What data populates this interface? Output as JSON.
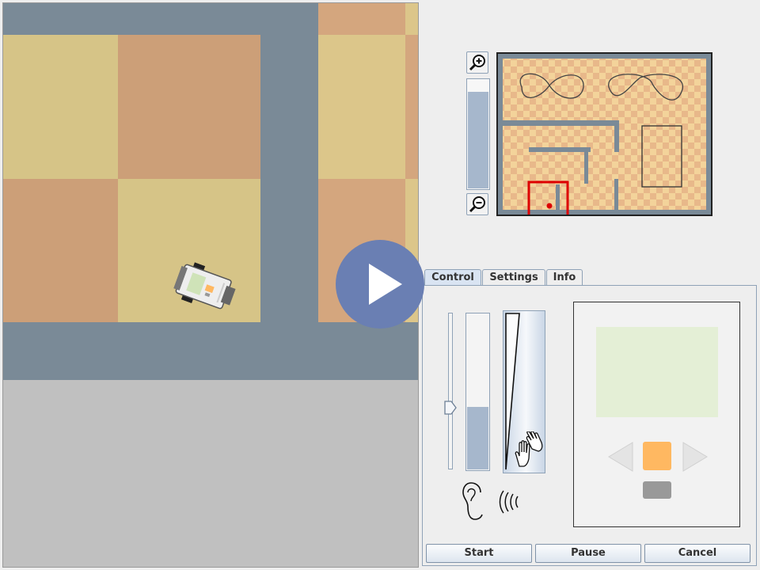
{
  "simulation": {
    "robot": "robot-icon",
    "play": "play-icon"
  },
  "zoom": {
    "zoom_in_icon": "zoom-in-icon",
    "zoom_out_icon": "zoom-out-icon",
    "level": 0.88
  },
  "tabs": [
    {
      "label": "Control",
      "active": true
    },
    {
      "label": "Settings",
      "active": false
    },
    {
      "label": "Info",
      "active": false
    }
  ],
  "control": {
    "slider_value": 0.4,
    "sound_level": 0.4,
    "ear_icon": "ear-icon",
    "sound_wave_icon": "sound-wave-icon",
    "touch_icon": "touch-hands-icon"
  },
  "brick": {
    "left_icon": "left-arrow-icon",
    "enter_color": "#ffb861",
    "right_icon": "right-arrow-icon",
    "escape_color": "#999999"
  },
  "buttons": {
    "start": "Start",
    "pause": "Pause",
    "cancel": "Cancel"
  },
  "colors": {
    "road": "#7a8a97",
    "tile_yellow": "#d6c487",
    "tile_orange": "#cc9f78",
    "accent": "#6a7fb3",
    "path_red": "#dd0000"
  }
}
